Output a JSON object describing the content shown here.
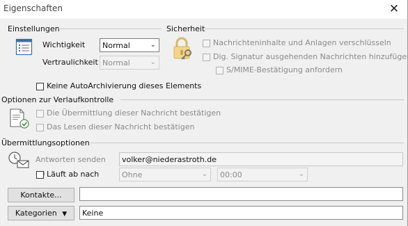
{
  "window": {
    "title": "Eigenschaften"
  },
  "settings": {
    "group_label": "Einstellungen",
    "importance_label": "Wichtigkeit",
    "importance_value": "Normal",
    "sensitivity_label": "Vertraulichkeit",
    "sensitivity_value": "Normal",
    "no_autoarchive_label": "Keine AutoArchivierung dieses Elements",
    "no_autoarchive_checked": false
  },
  "security": {
    "group_label": "Sicherheit",
    "encrypt_label": "Nachrichteninhalte und Anlagen verschlüsseln",
    "encrypt_checked": false,
    "signature_label": "Dig. Signatur ausgehenden Nachrichten hinzufügen",
    "signature_checked": false,
    "smime_label": "S/MIME-Bestätigung anfordern",
    "smime_checked": false
  },
  "tracking": {
    "group_label": "Optionen zur Verlaufkontrolle",
    "delivery_label": "Die Übermittlung dieser Nachricht bestätigen",
    "read_label": "Das Lesen dieser Nachricht bestätigen"
  },
  "delivery": {
    "group_label": "Übermittlungsoptionen",
    "reply_to_label": "Antworten senden an",
    "reply_to_value": "volker@niederastroth.de",
    "expires_label": "Läuft ab nach",
    "expires_checked": false,
    "expires_date_value": "Ohne",
    "expires_time_value": "00:00"
  },
  "contacts": {
    "button_label": "Kontakte...",
    "value": ""
  },
  "categories": {
    "button_label": "Kategorien",
    "value": "Keine"
  }
}
